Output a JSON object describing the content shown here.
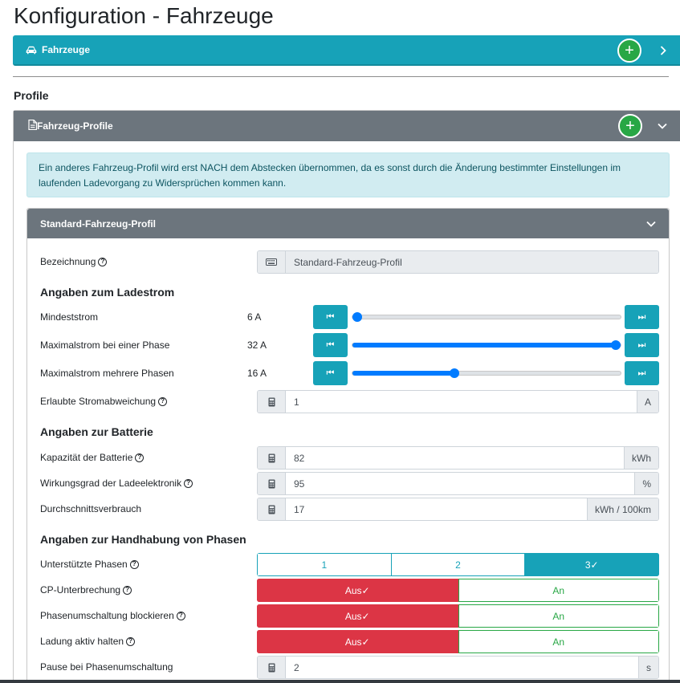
{
  "page": {
    "title": "Konfiguration - Fahrzeuge"
  },
  "vehicles_panel": {
    "title": "Fahrzeuge",
    "icon": "car-icon",
    "add_icon": "plus-icon",
    "chevron": "chevron-right-icon"
  },
  "profile_section": {
    "heading": "Profile"
  },
  "profiles_panel": {
    "title": "Fahrzeug-Profile",
    "icon": "file-icon",
    "alert": "Ein anderes Fahrzeug-Profil wird erst NACH dem Abstecken übernommen, da es sonst durch die Änderung bestimmter Einstellungen im laufenden Ladevorgang zu Widersprüchen kommen kann."
  },
  "standard_profile": {
    "title": "Standard-Fahrzeug-Profil",
    "name": {
      "label": "Bezeichnung",
      "value": "Standard-Fahrzeug-Profil",
      "icon": "keyboard-icon"
    },
    "charge_current": {
      "heading": "Angaben zum Ladestrom",
      "min": {
        "label": "Mindeststrom",
        "display": "6 A",
        "fraction": 0.0
      },
      "max_one": {
        "label": "Maximalstrom bei einer Phase",
        "display": "32 A",
        "fraction": 1.0
      },
      "max_multi": {
        "label": "Maximalstrom mehrere Phasen",
        "display": "16 A",
        "fraction": 0.38
      },
      "deviation": {
        "label": "Erlaubte Stromabweichung",
        "value": "1",
        "unit": "A"
      }
    },
    "battery": {
      "heading": "Angaben zur Batterie",
      "capacity": {
        "label": "Kapazität der Batterie",
        "value": "82",
        "unit": "kWh"
      },
      "efficiency": {
        "label": "Wirkungsgrad der Ladeelektronik",
        "value": "95",
        "unit": "%"
      },
      "consumption": {
        "label": "Durchschnittsverbrauch",
        "value": "17",
        "unit": "kWh / 100km"
      }
    },
    "phases": {
      "heading": "Angaben zur Handhabung von Phasen",
      "supported": {
        "label": "Unterstützte Phasen",
        "options": [
          "1",
          "2",
          "3✓"
        ],
        "selected": "3"
      },
      "cp_interrupt": {
        "label": "CP-Unterbrechung",
        "off": "Aus✓",
        "on": "An"
      },
      "block_switch": {
        "label": "Phasenumschaltung blockieren",
        "off": "Aus✓",
        "on": "An"
      },
      "keep_active": {
        "label": "Ladung aktiv halten",
        "off": "Aus✓",
        "on": "An"
      },
      "pause": {
        "label": "Pause bei Phasenumschaltung",
        "value": "2",
        "unit": "s"
      }
    }
  },
  "colors": {
    "info": "#17a2b8",
    "success": "#28a745",
    "danger": "#dc3545",
    "secondary": "#6c757d",
    "primary": "#007bff"
  }
}
